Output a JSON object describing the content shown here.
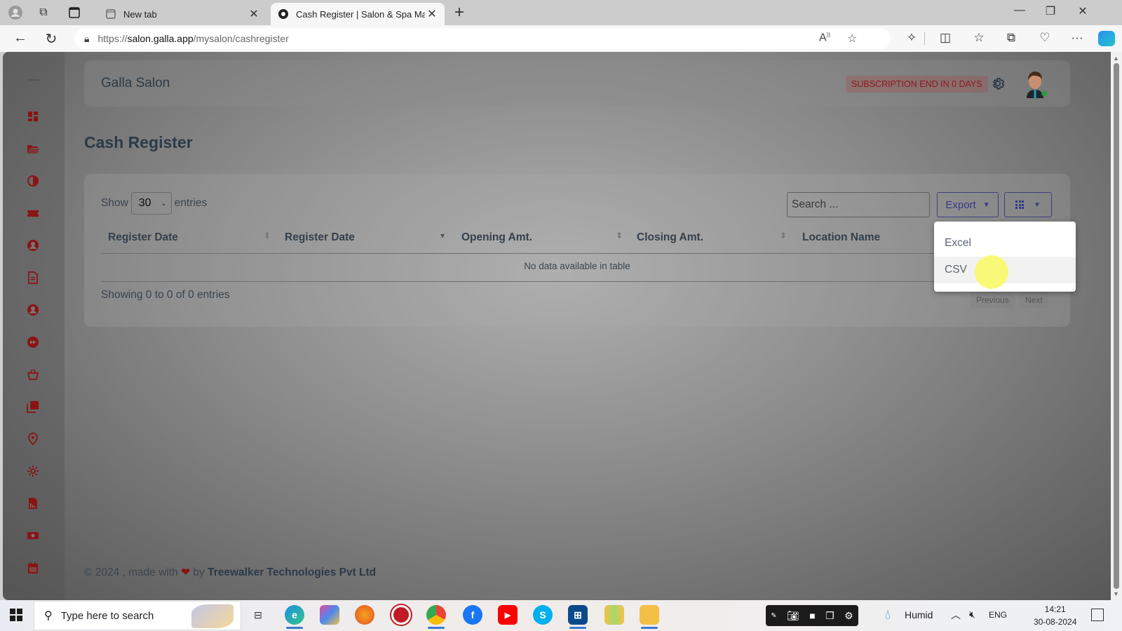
{
  "browser": {
    "tabs": [
      {
        "label": "New tab",
        "active": false
      },
      {
        "label": "Cash Register | Salon & Spa Mana",
        "active": true
      }
    ],
    "url_scheme": "https://",
    "url_host": "salon.galla.app",
    "url_path": "/mysalon/cashregister",
    "icons": [
      "profile-icon",
      "workspaces-icon",
      "tab-actions-icon",
      "back-icon",
      "refresh-icon",
      "lock-icon",
      "read-aloud-icon",
      "favorite-star-icon",
      "extensions-icon",
      "split-screen-icon",
      "favorites-icon",
      "collections-icon",
      "browser-essentials-icon",
      "more-icon",
      "copilot-icon"
    ]
  },
  "app": {
    "brand": "Galla Salon",
    "subscription_badge": "SUBSCRIPTION END IN 0 DAYS",
    "accent_color": "#8a1414",
    "sidebar_icons": [
      "dashboard-icon",
      "folder-open-icon",
      "contrast-icon",
      "discount-ticket-icon",
      "user-circle-icon",
      "document-icon",
      "user-circle-icon",
      "fast-forward-icon",
      "basket-icon",
      "contacts-icon",
      "location-pin-icon",
      "settings-icon",
      "report-file-icon",
      "cash-icon",
      "calendar-icon"
    ]
  },
  "page": {
    "title": "Cash Register",
    "length": {
      "show_label": "Show",
      "value": "30",
      "entries_label": "entries"
    },
    "search_placeholder": "Search ...",
    "export_label": "Export",
    "columns": [
      "Register Date",
      "Register Date",
      "Opening Amt.",
      "Closing Amt.",
      "Location Name"
    ],
    "empty_message": "No data available in table",
    "info": "Showing 0 to 0 of 0 entries",
    "pagination": {
      "previous": "Previous",
      "next": "Next"
    },
    "export_menu": [
      {
        "label": "Excel",
        "hovered": false
      },
      {
        "label": "CSV",
        "hovered": true
      }
    ]
  },
  "footer": {
    "prefix": "© 2024 , made with",
    "by": "by",
    "company": "Treewalker Technologies Pvt Ltd"
  },
  "taskbar": {
    "search_placeholder": "Type here to search",
    "weather": "Humid",
    "language": "ENG",
    "time": "14:21",
    "date": "30-08-2024"
  }
}
